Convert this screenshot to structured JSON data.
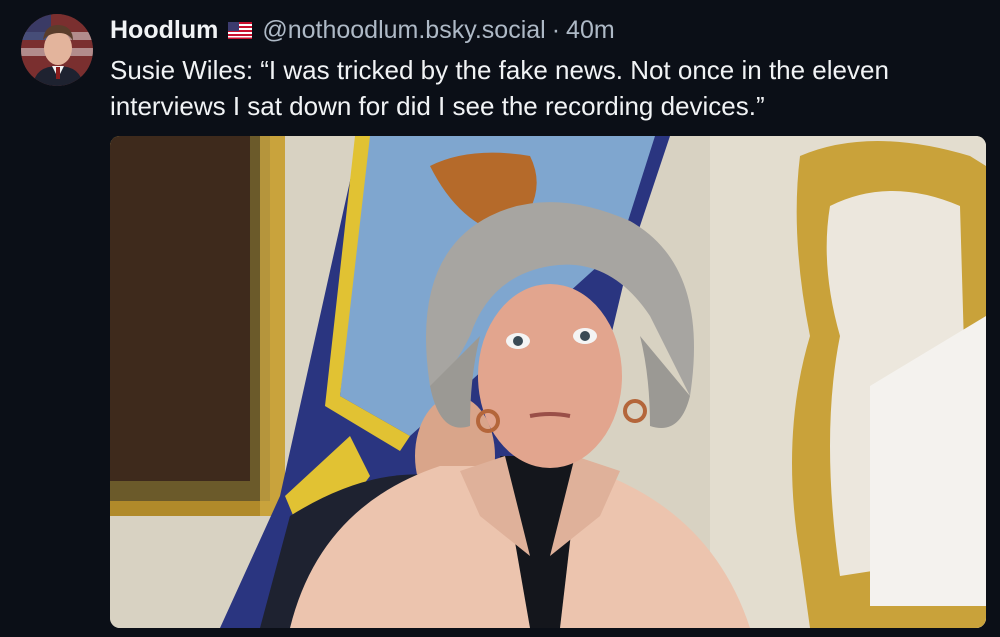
{
  "post": {
    "author_name": "Hoodlum",
    "author_flag_icon": "us-flag-icon",
    "handle": "@nothoodlum.bsky.social",
    "separator": "·",
    "timestamp": "40m",
    "text": "Susie Wiles: “I was tricked by the fake news. Not once in the eleven interviews I sat down for did I see the recording devices.”",
    "avatar_icon": "avatar-portrait",
    "image_icon": "photo-woman-gray-hair-pink-coat"
  },
  "colors": {
    "background": "#0b0f17",
    "text_primary": "#f1f3f5",
    "text_secondary": "#aeb9c6"
  }
}
